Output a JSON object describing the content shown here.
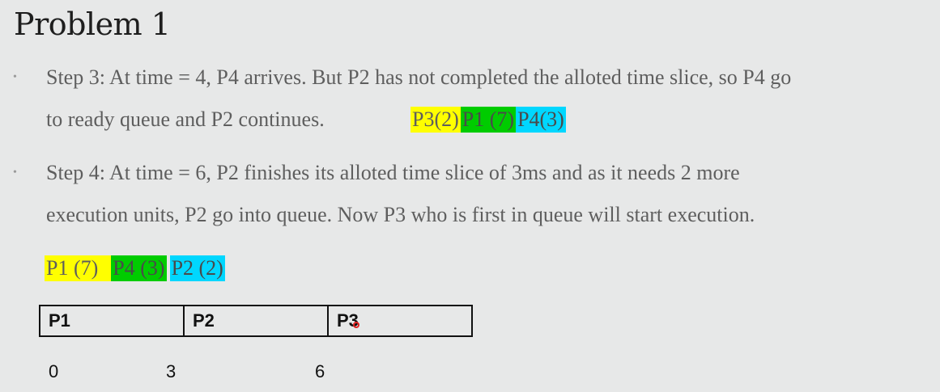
{
  "title": "Problem 1",
  "bullets": [
    {
      "symbol": "•",
      "lines": [
        "Step 3: At time = 4, P4 arrives. But P2 has not completed the alloted time slice, so P4 go",
        "to ready queue and P2 continues."
      ],
      "queue": [
        {
          "label": "P3(2)",
          "color": "#ffff00"
        },
        {
          "label": "P1 (7)",
          "color": "#00cc00"
        },
        {
          "label": "P4(3)",
          "color": "#00d7ff"
        }
      ]
    },
    {
      "symbol": "•",
      "lines": [
        "Step 4: At time = 6, P2 finishes its alloted time slice of 3ms and as it needs 2 more",
        "execution units, P2 go into queue. Now P3 who is first in queue will start execution."
      ]
    }
  ],
  "queue2": [
    {
      "label": "P1 (7)",
      "color": "#ffff00"
    },
    {
      "label": "P4 (3)",
      "color": "#00cc00"
    },
    {
      "label": "P2 (2)",
      "color": "#00d7ff"
    }
  ],
  "gantt": {
    "cells": [
      "P1",
      "P2",
      "P3"
    ],
    "ticks": [
      "0",
      "3",
      "6"
    ]
  }
}
